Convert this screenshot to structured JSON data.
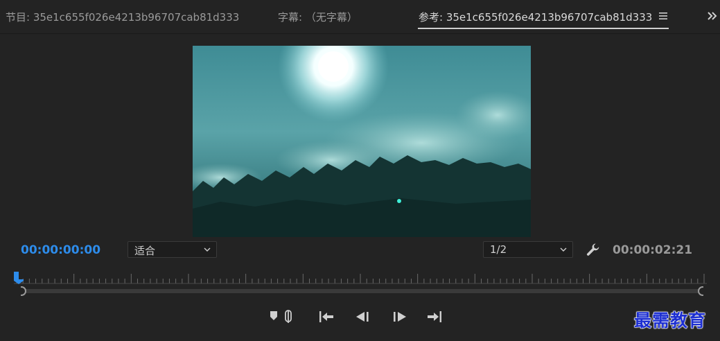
{
  "tabs": {
    "program": "节目: 35e1c655f026e4213b96707cab81d333",
    "captions": "字幕: （无字幕）",
    "reference": "参考: 35e1c655f026e4213b96707cab81d333"
  },
  "icons": {
    "panel_menu": "hamburger-menu-icon",
    "overflow": "double-chevron-right-icon",
    "settings": "wrench-icon",
    "add_marker": "add-marker-icon",
    "go_to_in": "go-to-in-icon",
    "step_back": "step-back-icon",
    "step_forward": "step-forward-icon",
    "go_to_out": "go-to-out-icon"
  },
  "monitor": {
    "current_timecode": "00:00:00:00",
    "duration_timecode": "00:00:02:21",
    "zoom_value": "适合",
    "resolution_value": "1/2"
  },
  "playhead_position": 0,
  "watermark": "最需教育",
  "colors": {
    "accent": "#2d8ceb",
    "background": "#232323"
  }
}
